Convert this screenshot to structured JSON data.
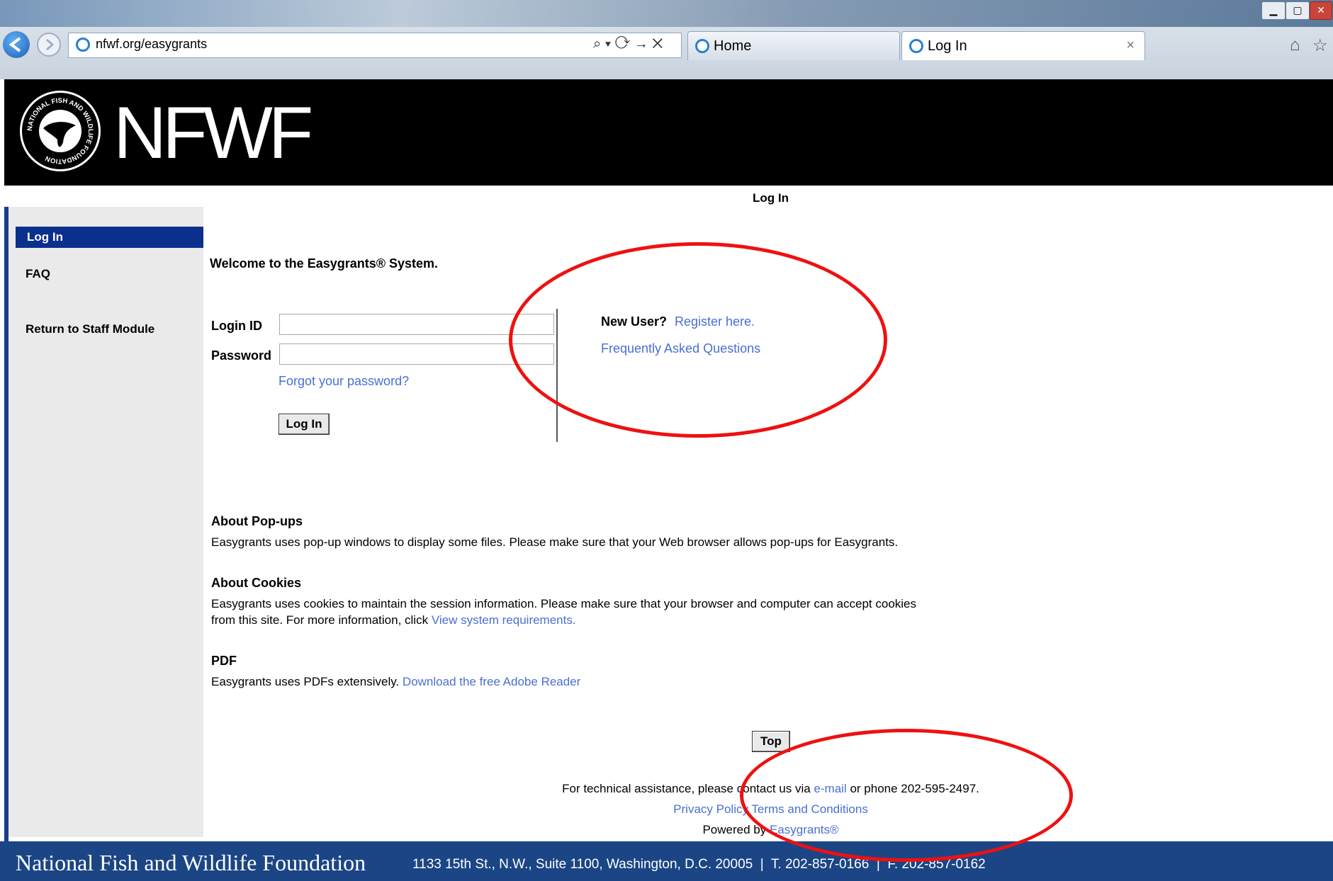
{
  "browser": {
    "address": "nfwf.org/easygrants",
    "address_controls": "⌕ ▾ ⟳ → ✕",
    "tabs": [
      {
        "label": "Home"
      },
      {
        "label": "Log In",
        "close": "×"
      }
    ]
  },
  "header": {
    "logo_text": "NFWF",
    "seal_text": "NATIONAL FISH AND WILDLIFE FOUNDATION",
    "page_title": "Log In"
  },
  "sidebar": {
    "items": [
      {
        "label": "Log In",
        "active": true
      },
      {
        "label": "FAQ"
      },
      {
        "label": "Return to Staff Module"
      }
    ]
  },
  "main": {
    "welcome": "Welcome to the Easygrants® System.",
    "login_id_label": "Login ID",
    "login_id_value": "",
    "password_label": "Password",
    "password_value": "",
    "forgot_password": "Forgot your password?",
    "login_button": "Log In",
    "new_user_label": "New User?",
    "register_link": "Register here.",
    "faq_link": "Frequently Asked Questions",
    "popups_heading": "About Pop-ups",
    "popups_text": "Easygrants uses pop-up windows to display some files. Please make sure that your Web browser allows pop-ups for Easygrants.",
    "cookies_heading": "About Cookies",
    "cookies_text1": "Easygrants uses cookies to maintain the session information. Please make sure that your browser and computer can accept cookies",
    "cookies_text2": "from this site. For more information, click",
    "cookies_link": "View system requirements.",
    "pdf_heading": "PDF",
    "pdf_text": "Easygrants uses PDFs extensively.",
    "pdf_link": "Download the free Adobe Reader",
    "top_button": "Top",
    "assist_text1": "For technical assistance, please contact us via",
    "assist_email": "e-mail",
    "assist_text2": "or phone 202-595-2497.",
    "privacy_link": "Privacy Policy",
    "terms_link": "Terms and Conditions",
    "powered_by": "Powered by",
    "powered_link": "Easygrants®"
  },
  "footer": {
    "org": "National Fish and Wildlife Foundation",
    "address": "1133 15th St., N.W., Suite 1100, Washington, D.C. 20005  |  T. 202-857-0166  |  F. 202-857-0162"
  },
  "colors": {
    "header_bg": "#000000",
    "sidebar_active": "#0a2f8c",
    "link": "#4a6fd1",
    "footer_bg": "#1b4585",
    "annotation": "#ee1111"
  }
}
